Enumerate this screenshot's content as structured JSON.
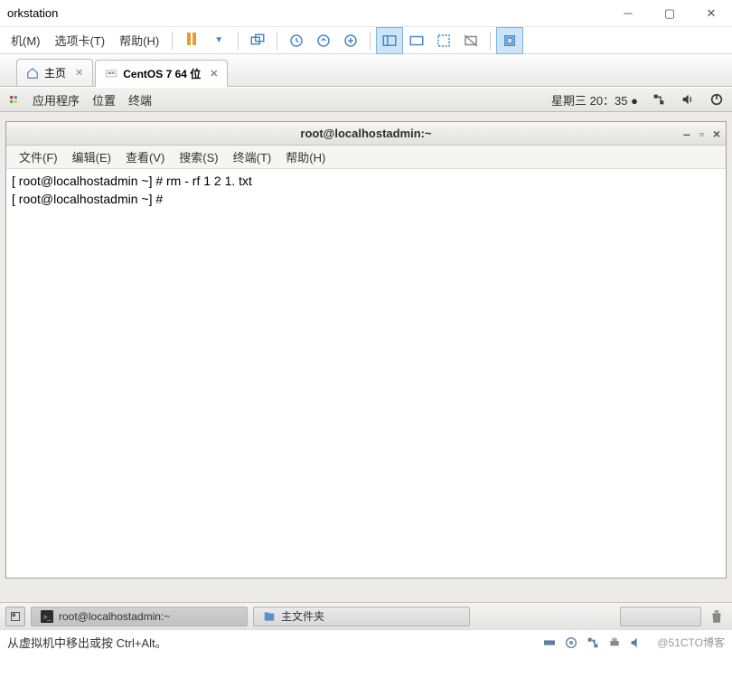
{
  "window": {
    "title": "orkstation"
  },
  "menubar": {
    "items": [
      "机(M)",
      "选项卡(T)",
      "帮助(H)"
    ]
  },
  "tabs": {
    "home": {
      "label": "主页"
    },
    "vm": {
      "label": "CentOS 7 64 位"
    }
  },
  "gnome_top": {
    "apps": "应用程序",
    "places": "位置",
    "terminal": "终端",
    "clock": "星期三  20：35"
  },
  "terminal": {
    "title": "root@localhostadmin:~",
    "menus": [
      "文件(F)",
      "编辑(E)",
      "查看(V)",
      "搜索(S)",
      "终端(T)",
      "帮助(H)"
    ],
    "lines": [
      "[ root@localhostadmin ~] # rm - rf 1 2 1. txt",
      "[ root@localhostadmin ~] #"
    ]
  },
  "gnome_bottom": {
    "task1": "root@localhostadmin:~",
    "task2": "主文件夹"
  },
  "status": {
    "hint": "从虚拟机中移出或按 Ctrl+Alt。",
    "watermark": "@51CTO博客"
  }
}
